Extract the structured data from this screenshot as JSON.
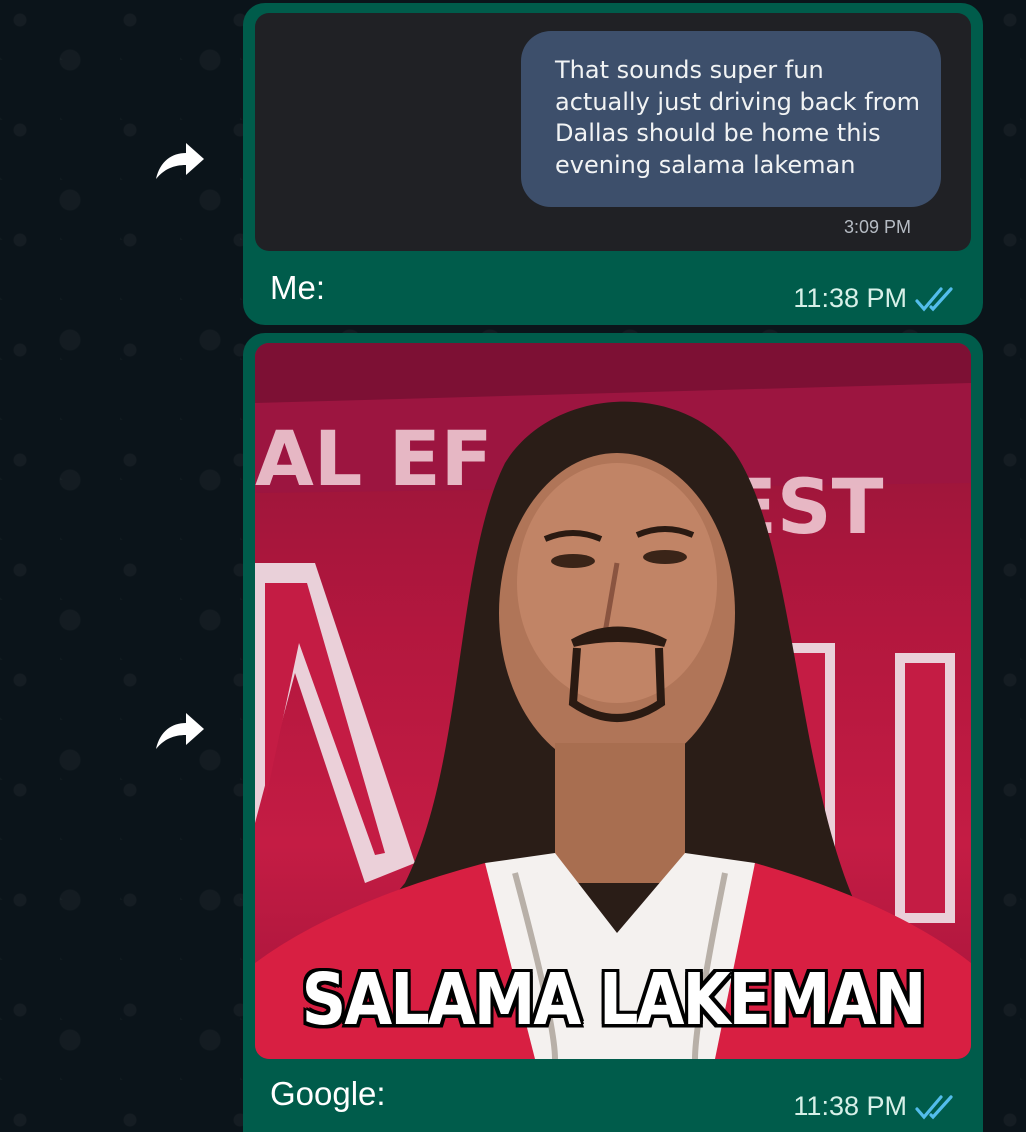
{
  "messages": [
    {
      "forwarded_screenshot": {
        "text": "That sounds super fun actually just driving back from Dallas should be home this evening salama lakeman",
        "time": "3:09 PM"
      },
      "caption": "Me:",
      "time": "11:38 PM",
      "status": "read"
    },
    {
      "image_caption_text": "SALAMA LAKEMAN",
      "caption": "Google:",
      "time": "11:38 PM",
      "status": "read"
    }
  ],
  "icons": {
    "forward": "forward-arrow-icon",
    "read_receipt": "double-check-icon"
  },
  "colors": {
    "background": "#0b141a",
    "outgoing_bubble": "#005c4b",
    "read_ticks": "#53bdeb",
    "inner_bubble": "#3d4f6b"
  }
}
